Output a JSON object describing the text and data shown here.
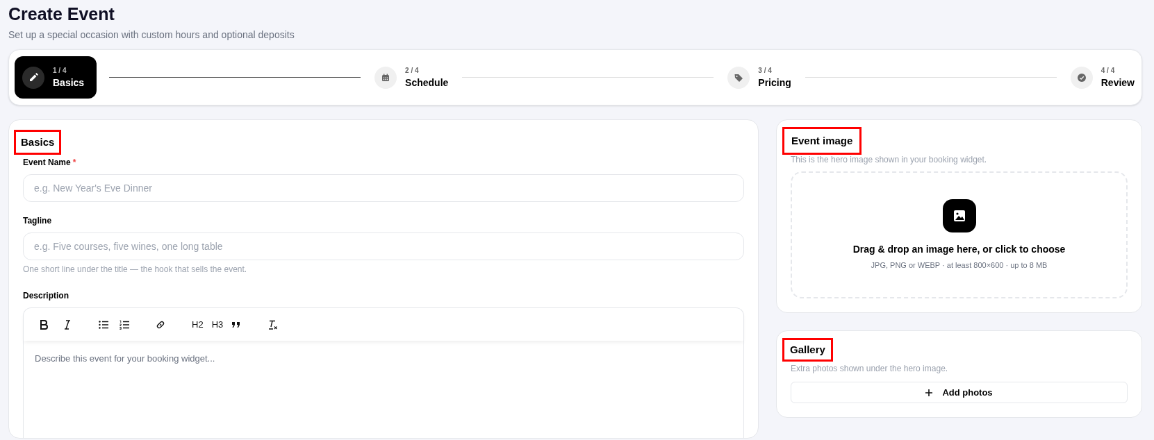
{
  "header": {
    "title": "Create Event",
    "subtitle": "Set up a special occasion with custom hours and optional deposits"
  },
  "steps": [
    {
      "kind": "edit",
      "count": "1 / 4",
      "label": "Basics",
      "selected": true
    },
    {
      "kind": "calendar",
      "count": "2 / 4",
      "label": "Schedule",
      "selected": false
    },
    {
      "kind": "tag",
      "count": "3 / 4",
      "label": "Pricing",
      "selected": false
    },
    {
      "kind": "check",
      "count": "4 / 4",
      "label": "Review",
      "selected": false
    }
  ],
  "basics": {
    "heading": "Basics",
    "highlighted": true,
    "fields": [
      {
        "label": "Event Name",
        "required_mark": "*",
        "placeholder": "e.g. New Year's Eve Dinner"
      },
      {
        "label": "Tagline",
        "placeholder": "e.g. Five courses, five wines, one long table",
        "hint": "One short line under the title — the hook that sells the event."
      }
    ],
    "description": {
      "label": "Description",
      "placeholder": "Describe this event for your booking widget...",
      "toolbar": [
        {
          "kind": "bold"
        },
        {
          "kind": "italic"
        },
        {
          "kind": "bullets"
        },
        {
          "kind": "numbers"
        },
        {
          "kind": "link"
        },
        {
          "kind": "text",
          "label": "H2"
        },
        {
          "kind": "text",
          "label": "H3"
        },
        {
          "kind": "quote"
        },
        {
          "kind": "clear"
        }
      ]
    }
  },
  "event_image": {
    "heading": "Event image",
    "highlighted": true,
    "subtitle": "This is the hero image shown in your booking widget.",
    "dropzone": {
      "title": "Drag & drop an image here, or click to choose",
      "hint": "JPG, PNG or WEBP · at least 800×600 · up to 8 MB"
    }
  },
  "gallery": {
    "heading": "Gallery",
    "highlighted": true,
    "subtitle": "Extra photos shown under the hero image.",
    "button": "Add photos"
  }
}
